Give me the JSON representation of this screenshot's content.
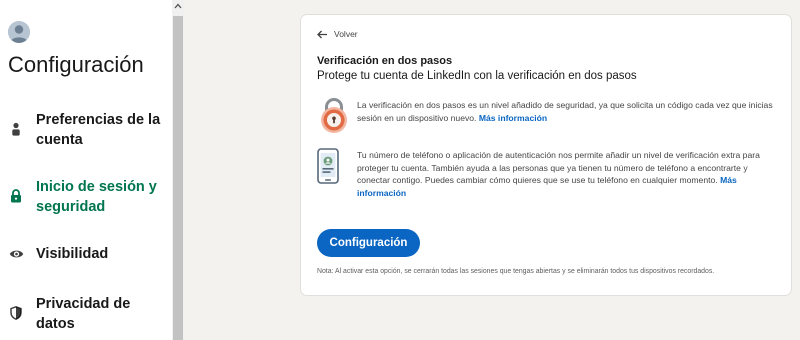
{
  "sidebar": {
    "title": "Configuración",
    "items": [
      {
        "label": "Preferencias de la cuenta",
        "icon": "person-icon",
        "active": false
      },
      {
        "label": "Inicio de sesión y seguridad",
        "icon": "lock-icon",
        "active": true
      },
      {
        "label": "Visibilidad",
        "icon": "eye-icon",
        "active": false
      },
      {
        "label": "Privacidad de datos",
        "icon": "shield-icon",
        "active": false
      }
    ]
  },
  "card": {
    "back_label": "Volver",
    "title": "Verificación en dos pasos",
    "subtitle": "Protege tu cuenta de LinkedIn con la verificación en dos pasos",
    "info": [
      {
        "text": "La verificación en dos pasos es un nivel añadido de seguridad, ya que solicita un código cada vez que inicias sesión en un dispositivo nuevo.",
        "link": "Más información",
        "icon": "padlock-icon"
      },
      {
        "text": "Tu número de teléfono o aplicación de autenticación nos permite añadir un nivel de verificación extra para proteger tu cuenta. También ayuda a las personas que ya tienen tu número de teléfono a encontrarte y conectar contigo. Puedes cambiar cómo quieres que se use tu teléfono en cualquier momento.",
        "link": "Más información",
        "icon": "phone-icon"
      }
    ],
    "button_label": "Configuración",
    "note": "Nota: Al activar esta opción, se cerrarán todas las sesiones que tengas abiertas y se eliminarán todos tus dispositivos recordados."
  },
  "colors": {
    "accent": "#0a66c2",
    "active_nav": "#01754f",
    "background": "#f3f2ef"
  }
}
